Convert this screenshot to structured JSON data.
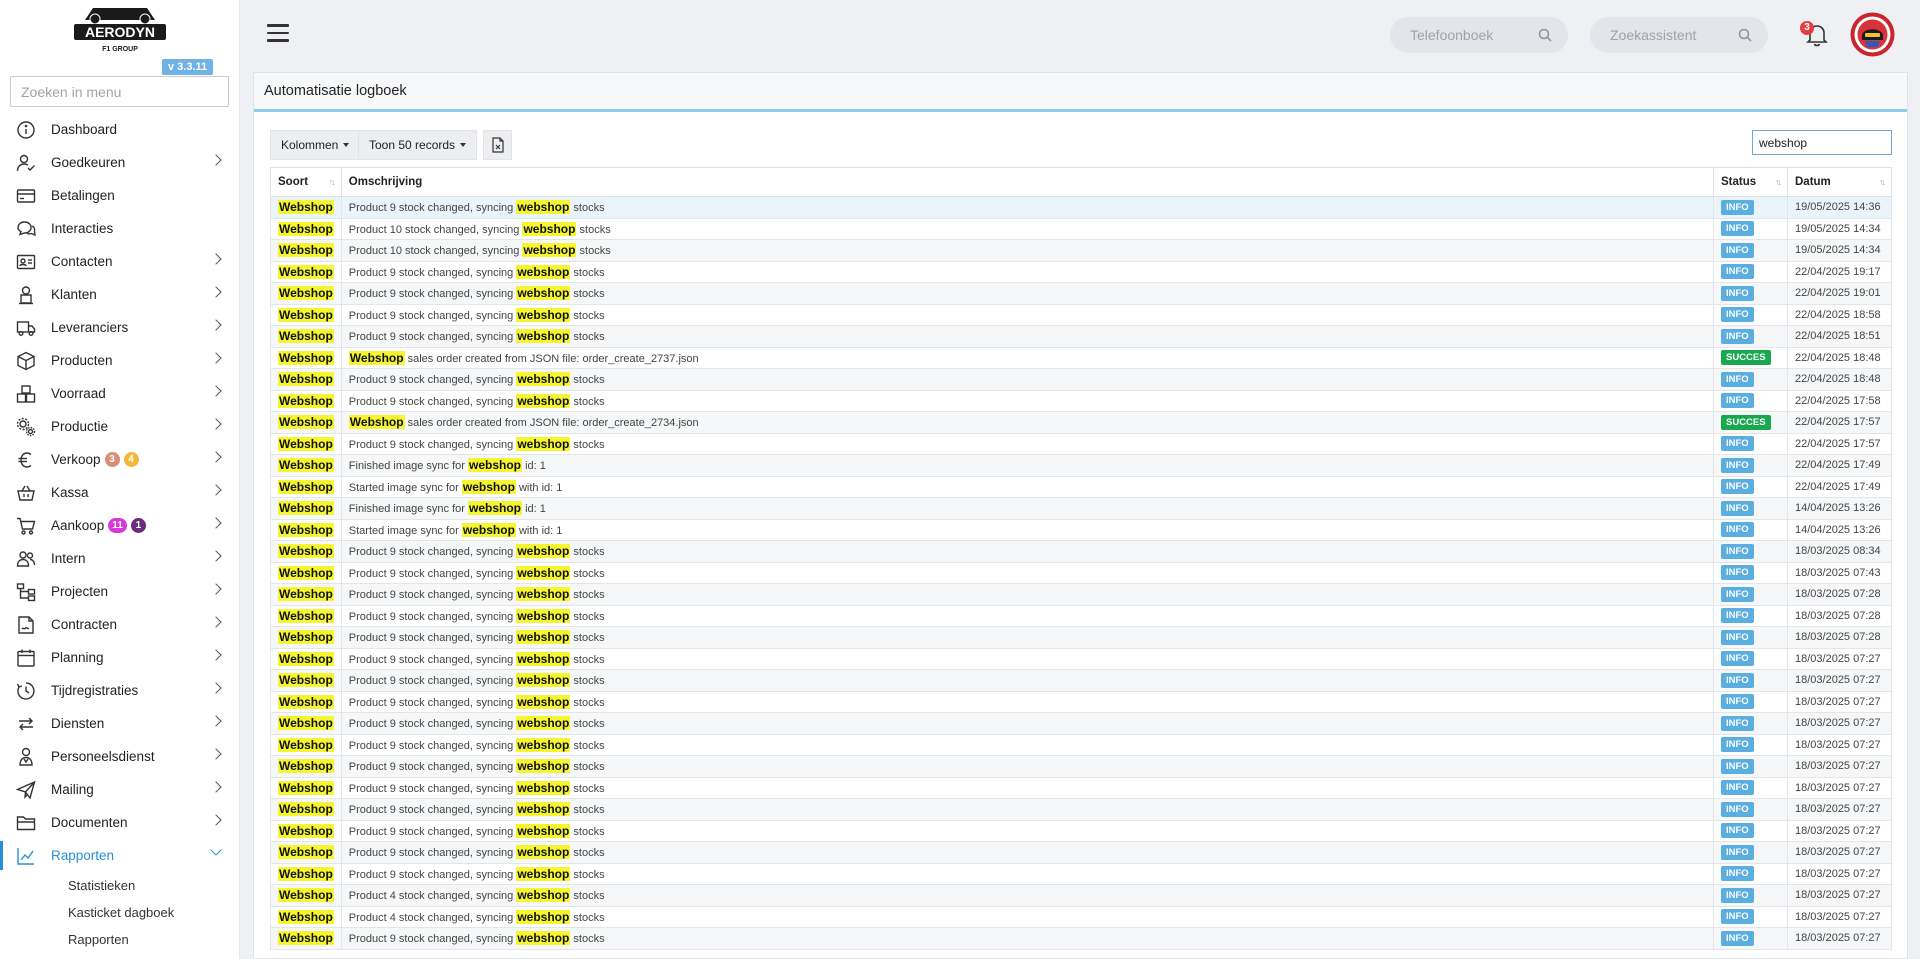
{
  "sidebar": {
    "logo_text": "AERODYN",
    "logo_sub": "F1 GROUP",
    "version": "v 3.3.11",
    "search_placeholder": "Zoeken in menu",
    "items": [
      {
        "key": "dashboard",
        "label": "Dashboard",
        "icon": "dashboard-icon",
        "chevron": false
      },
      {
        "key": "goedkeuren",
        "label": "Goedkeuren",
        "icon": "user-check-icon",
        "chevron": true
      },
      {
        "key": "betalingen",
        "label": "Betalingen",
        "icon": "credit-card-icon",
        "chevron": false
      },
      {
        "key": "interacties",
        "label": "Interacties",
        "icon": "chat-bubbles-icon",
        "chevron": false
      },
      {
        "key": "contacten",
        "label": "Contacten",
        "icon": "contact-card-icon",
        "chevron": true
      },
      {
        "key": "klanten",
        "label": "Klanten",
        "icon": "customer-icon",
        "chevron": true
      },
      {
        "key": "leveranciers",
        "label": "Leveranciers",
        "icon": "truck-icon",
        "chevron": true
      },
      {
        "key": "producten",
        "label": "Producten",
        "icon": "box-icon",
        "chevron": true
      },
      {
        "key": "voorraad",
        "label": "Voorraad",
        "icon": "boxes-icon",
        "chevron": true
      },
      {
        "key": "productie",
        "label": "Productie",
        "icon": "gears-icon",
        "chevron": true
      },
      {
        "key": "verkoop",
        "label": "Verkoop",
        "icon": "euro-icon",
        "chevron": true,
        "badges": [
          {
            "text": "3",
            "color": "#d98e75"
          },
          {
            "text": "4",
            "color": "#f0b93a"
          }
        ]
      },
      {
        "key": "kassa",
        "label": "Kassa",
        "icon": "basket-icon",
        "chevron": true
      },
      {
        "key": "aankoop",
        "label": "Aankoop",
        "icon": "cart-icon",
        "chevron": true,
        "badges": [
          {
            "text": "11",
            "color": "#d63ad8"
          },
          {
            "text": "1",
            "color": "#6b2d7a"
          }
        ]
      },
      {
        "key": "intern",
        "label": "Intern",
        "icon": "users-icon",
        "chevron": true
      },
      {
        "key": "projecten",
        "label": "Projecten",
        "icon": "project-tree-icon",
        "chevron": true
      },
      {
        "key": "contracten",
        "label": "Contracten",
        "icon": "contract-icon",
        "chevron": true
      },
      {
        "key": "planning",
        "label": "Planning",
        "icon": "calendar-icon",
        "chevron": true
      },
      {
        "key": "tijdregistraties",
        "label": "Tijdregistraties",
        "icon": "clock-icon",
        "chevron": true
      },
      {
        "key": "diensten",
        "label": "Diensten",
        "icon": "exchange-icon",
        "chevron": true
      },
      {
        "key": "personeelsdienst",
        "label": "Personeelsdienst",
        "icon": "staff-icon",
        "chevron": true
      },
      {
        "key": "mailing",
        "label": "Mailing",
        "icon": "paper-plane-icon",
        "chevron": true
      },
      {
        "key": "documenten",
        "label": "Documenten",
        "icon": "folder-icon",
        "chevron": true
      },
      {
        "key": "rapporten",
        "label": "Rapporten",
        "icon": "chart-line-icon",
        "chevron": true,
        "active": true
      }
    ],
    "subitems": [
      "Statistieken",
      "Kasticket dagboek",
      "Rapporten"
    ]
  },
  "topbar": {
    "search1_placeholder": "Telefoonboek",
    "search2_placeholder": "Zoekassistent",
    "notification_count": "3"
  },
  "card": {
    "title": "Automatisatie logboek",
    "btn_columns": "Kolommen",
    "btn_records": "Toon 50 records",
    "filter_value": "webshop",
    "columns": {
      "soort": "Soort",
      "omschrijving": "Omschrijving",
      "status": "Status",
      "datum": "Datum"
    },
    "rows": [
      {
        "soort": "Webshop",
        "pre": "Product 9 stock changed, syncing ",
        "hit": "webshop",
        "post": " stocks",
        "status": "INFO",
        "datum": "19/05/2025 14:36"
      },
      {
        "soort": "Webshop",
        "pre": "Product 10 stock changed, syncing ",
        "hit": "webshop",
        "post": " stocks",
        "status": "INFO",
        "datum": "19/05/2025 14:34"
      },
      {
        "soort": "Webshop",
        "pre": "Product 10 stock changed, syncing ",
        "hit": "webshop",
        "post": " stocks",
        "status": "INFO",
        "datum": "19/05/2025 14:34"
      },
      {
        "soort": "Webshop",
        "pre": "Product 9 stock changed, syncing ",
        "hit": "webshop",
        "post": " stocks",
        "status": "INFO",
        "datum": "22/04/2025 19:17"
      },
      {
        "soort": "Webshop",
        "pre": "Product 9 stock changed, syncing ",
        "hit": "webshop",
        "post": " stocks",
        "status": "INFO",
        "datum": "22/04/2025 19:01"
      },
      {
        "soort": "Webshop",
        "pre": "Product 9 stock changed, syncing ",
        "hit": "webshop",
        "post": " stocks",
        "status": "INFO",
        "datum": "22/04/2025 18:58"
      },
      {
        "soort": "Webshop",
        "pre": "Product 9 stock changed, syncing ",
        "hit": "webshop",
        "post": " stocks",
        "status": "INFO",
        "datum": "22/04/2025 18:51"
      },
      {
        "soort": "Webshop",
        "pre": "",
        "hit": "Webshop",
        "post": " sales order created from JSON file: order_create_2737.json",
        "status": "SUCCES",
        "datum": "22/04/2025 18:48"
      },
      {
        "soort": "Webshop",
        "pre": "Product 9 stock changed, syncing ",
        "hit": "webshop",
        "post": " stocks",
        "status": "INFO",
        "datum": "22/04/2025 18:48"
      },
      {
        "soort": "Webshop",
        "pre": "Product 9 stock changed, syncing ",
        "hit": "webshop",
        "post": " stocks",
        "status": "INFO",
        "datum": "22/04/2025 17:58"
      },
      {
        "soort": "Webshop",
        "pre": "",
        "hit": "Webshop",
        "post": " sales order created from JSON file: order_create_2734.json",
        "status": "SUCCES",
        "datum": "22/04/2025 17:57"
      },
      {
        "soort": "Webshop",
        "pre": "Product 9 stock changed, syncing ",
        "hit": "webshop",
        "post": " stocks",
        "status": "INFO",
        "datum": "22/04/2025 17:57"
      },
      {
        "soort": "Webshop",
        "pre": "Finished image sync for ",
        "hit": "webshop",
        "post": " id: 1",
        "status": "INFO",
        "datum": "22/04/2025 17:49"
      },
      {
        "soort": "Webshop",
        "pre": "Started image sync for ",
        "hit": "webshop",
        "post": " with id: 1",
        "status": "INFO",
        "datum": "22/04/2025 17:49"
      },
      {
        "soort": "Webshop",
        "pre": "Finished image sync for ",
        "hit": "webshop",
        "post": " id: 1",
        "status": "INFO",
        "datum": "14/04/2025 13:26"
      },
      {
        "soort": "Webshop",
        "pre": "Started image sync for ",
        "hit": "webshop",
        "post": " with id: 1",
        "status": "INFO",
        "datum": "14/04/2025 13:26"
      },
      {
        "soort": "Webshop",
        "pre": "Product 9 stock changed, syncing ",
        "hit": "webshop",
        "post": " stocks",
        "status": "INFO",
        "datum": "18/03/2025 08:34"
      },
      {
        "soort": "Webshop",
        "pre": "Product 9 stock changed, syncing ",
        "hit": "webshop",
        "post": " stocks",
        "status": "INFO",
        "datum": "18/03/2025 07:43"
      },
      {
        "soort": "Webshop",
        "pre": "Product 9 stock changed, syncing ",
        "hit": "webshop",
        "post": " stocks",
        "status": "INFO",
        "datum": "18/03/2025 07:28"
      },
      {
        "soort": "Webshop",
        "pre": "Product 9 stock changed, syncing ",
        "hit": "webshop",
        "post": " stocks",
        "status": "INFO",
        "datum": "18/03/2025 07:28"
      },
      {
        "soort": "Webshop",
        "pre": "Product 9 stock changed, syncing ",
        "hit": "webshop",
        "post": " stocks",
        "status": "INFO",
        "datum": "18/03/2025 07:28"
      },
      {
        "soort": "Webshop",
        "pre": "Product 9 stock changed, syncing ",
        "hit": "webshop",
        "post": " stocks",
        "status": "INFO",
        "datum": "18/03/2025 07:27"
      },
      {
        "soort": "Webshop",
        "pre": "Product 9 stock changed, syncing ",
        "hit": "webshop",
        "post": " stocks",
        "status": "INFO",
        "datum": "18/03/2025 07:27"
      },
      {
        "soort": "Webshop",
        "pre": "Product 9 stock changed, syncing ",
        "hit": "webshop",
        "post": " stocks",
        "status": "INFO",
        "datum": "18/03/2025 07:27"
      },
      {
        "soort": "Webshop",
        "pre": "Product 9 stock changed, syncing ",
        "hit": "webshop",
        "post": " stocks",
        "status": "INFO",
        "datum": "18/03/2025 07:27"
      },
      {
        "soort": "Webshop",
        "pre": "Product 9 stock changed, syncing ",
        "hit": "webshop",
        "post": " stocks",
        "status": "INFO",
        "datum": "18/03/2025 07:27"
      },
      {
        "soort": "Webshop",
        "pre": "Product 9 stock changed, syncing ",
        "hit": "webshop",
        "post": " stocks",
        "status": "INFO",
        "datum": "18/03/2025 07:27"
      },
      {
        "soort": "Webshop",
        "pre": "Product 9 stock changed, syncing ",
        "hit": "webshop",
        "post": " stocks",
        "status": "INFO",
        "datum": "18/03/2025 07:27"
      },
      {
        "soort": "Webshop",
        "pre": "Product 9 stock changed, syncing ",
        "hit": "webshop",
        "post": " stocks",
        "status": "INFO",
        "datum": "18/03/2025 07:27"
      },
      {
        "soort": "Webshop",
        "pre": "Product 9 stock changed, syncing ",
        "hit": "webshop",
        "post": " stocks",
        "status": "INFO",
        "datum": "18/03/2025 07:27"
      },
      {
        "soort": "Webshop",
        "pre": "Product 9 stock changed, syncing ",
        "hit": "webshop",
        "post": " stocks",
        "status": "INFO",
        "datum": "18/03/2025 07:27"
      },
      {
        "soort": "Webshop",
        "pre": "Product 9 stock changed, syncing ",
        "hit": "webshop",
        "post": " stocks",
        "status": "INFO",
        "datum": "18/03/2025 07:27"
      },
      {
        "soort": "Webshop",
        "pre": "Product 4 stock changed, syncing ",
        "hit": "webshop",
        "post": " stocks",
        "status": "INFO",
        "datum": "18/03/2025 07:27"
      },
      {
        "soort": "Webshop",
        "pre": "Product 4 stock changed, syncing ",
        "hit": "webshop",
        "post": " stocks",
        "status": "INFO",
        "datum": "18/03/2025 07:27"
      },
      {
        "soort": "Webshop",
        "pre": "Product 9 stock changed, syncing ",
        "hit": "webshop",
        "post": " stocks",
        "status": "INFO",
        "datum": "18/03/2025 07:27"
      }
    ]
  }
}
